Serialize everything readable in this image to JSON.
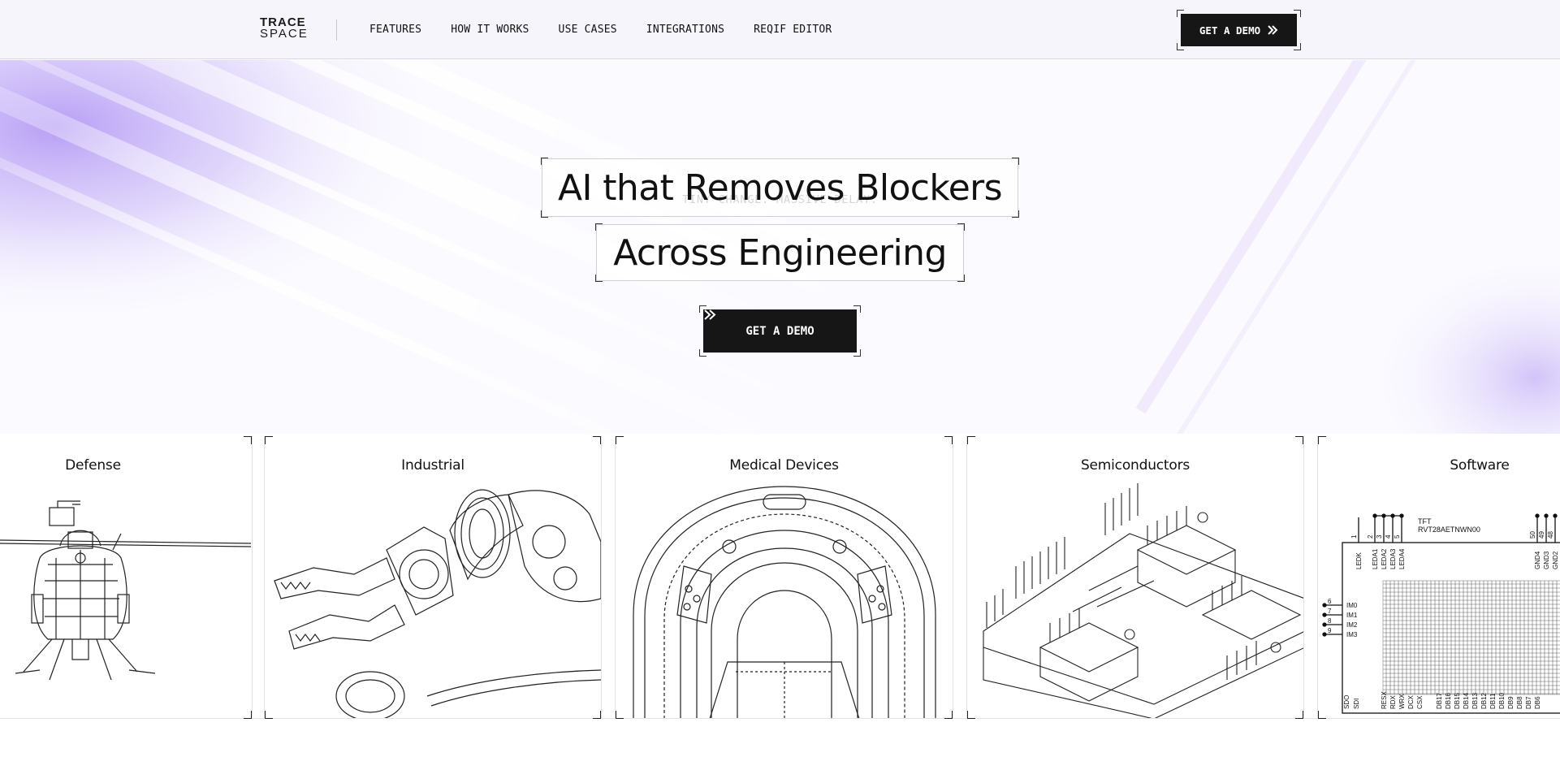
{
  "nav": {
    "logo_line1": "TRACE",
    "logo_line2": "SPACE",
    "links": [
      "FEATURES",
      "HOW IT WORKS",
      "USE CASES",
      "INTEGRATIONS",
      "REQIF EDITOR"
    ],
    "cta_label": "GET A DEMO",
    "cta_icon": "double-chevron-right-icon"
  },
  "hero": {
    "eyebrow": "TINY CHANGE. MASSIVE DELAY.",
    "headline_line1": "AI that Removes Blockers",
    "headline_line2": "Across Engineering",
    "cta_label": "GET A DEMO",
    "cta_icon": "double-chevron-right-icon",
    "accent_color": "#a98bf2"
  },
  "cards": [
    {
      "title": "Defense",
      "illustration": "helicopter-wireframe"
    },
    {
      "title": "Industrial",
      "illustration": "robot-arm-wireframe"
    },
    {
      "title": "Medical Devices",
      "illustration": "mri-scanner-wireframe"
    },
    {
      "title": "Semiconductors",
      "illustration": "circuit-board-wireframe"
    },
    {
      "title": "Software",
      "illustration": "tft-pinout-schematic"
    }
  ],
  "schematic": {
    "top_pins": [
      "1",
      "2",
      "3",
      "4",
      "5"
    ],
    "chip_label": "TFT",
    "chip_part": "RVT28AETNWN00",
    "leds": [
      "LEDK",
      "LEDA1",
      "LEDA2",
      "LEDA3",
      "LEDA4"
    ],
    "right_pins": [
      "50",
      "49",
      "48"
    ],
    "right_labels": [
      "GND4",
      "GND3",
      "GND2"
    ],
    "side_pins": [
      "6",
      "7",
      "8",
      "9"
    ],
    "side_labels": [
      "IM0",
      "IM1",
      "IM2",
      "IM3"
    ],
    "bottom_labels": [
      "SDO",
      "SDI",
      "RESX",
      "RDX",
      "WRX",
      "DCX",
      "CSX",
      "DB17",
      "DB16",
      "DB15",
      "DB14",
      "DB13",
      "DB12",
      "DB11",
      "DB10",
      "DB9",
      "DB8",
      "DB7",
      "DB6"
    ]
  }
}
